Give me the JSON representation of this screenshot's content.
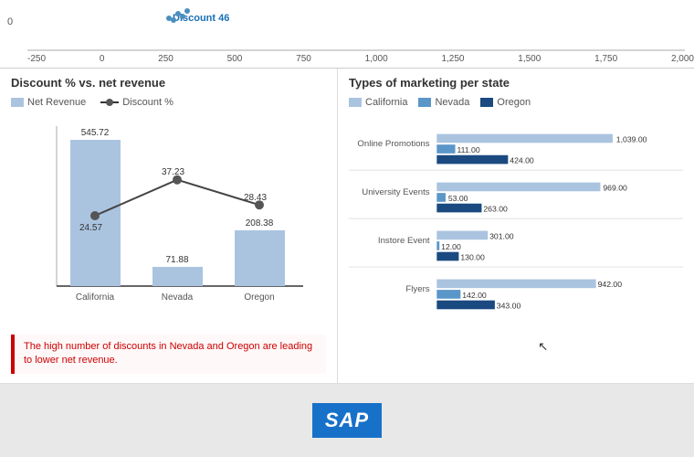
{
  "top": {
    "y_zero": "0",
    "x_axis": [
      "-250",
      "0",
      "250",
      "500",
      "750",
      "1,000",
      "1,250",
      "1,500",
      "1,750",
      "2,000"
    ],
    "discount_label": "Discount 46"
  },
  "left": {
    "title": "Discount % vs. net revenue",
    "legend_net_revenue": "Net Revenue",
    "legend_discount": "Discount %",
    "bars": [
      {
        "label": "California",
        "value": 545.72,
        "discount": 24.57
      },
      {
        "label": "Nevada",
        "value": 71.88,
        "discount": 37.23
      },
      {
        "label": "Oregon",
        "value": 208.38,
        "discount": 28.43
      }
    ],
    "insight": "The high number of discounts in Nevada and Oregon are leading to lower net revenue."
  },
  "right": {
    "title": "Types of marketing per state",
    "legend": [
      "California",
      "Nevada",
      "Oregon"
    ],
    "categories": [
      {
        "label": "Online Promotions",
        "values": [
          1039.0,
          111.0,
          424.0
        ]
      },
      {
        "label": "University Events",
        "values": [
          969.0,
          53.0,
          263.0
        ]
      },
      {
        "label": "Instore Event",
        "values": [
          301.0,
          12.0,
          130.0
        ]
      },
      {
        "label": "Flyers",
        "values": [
          942.0,
          142.0,
          343.0
        ]
      }
    ]
  },
  "footer": {
    "logo": "SAP"
  }
}
